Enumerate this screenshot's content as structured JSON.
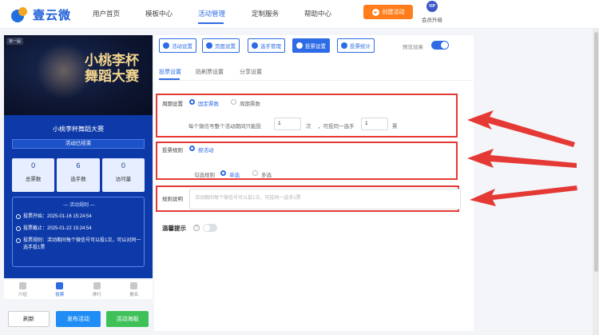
{
  "brand": {
    "name": "壹云微"
  },
  "nav": {
    "items": [
      "用户首页",
      "模板中心",
      "活动管理",
      "定制服务",
      "帮助中心"
    ],
    "active": "活动管理",
    "create_label": "创建活动",
    "vip_badge": "VIP",
    "vip_label": "会员升级"
  },
  "preview": {
    "corner_tag": "第一届",
    "banner_title_line1": "小桃李杯",
    "banner_title_line2": "舞蹈大赛",
    "activity_name": "小桃李杯舞蹈大赛",
    "status": "活动已结束",
    "stats": [
      {
        "value": "0",
        "label": "总票数"
      },
      {
        "value": "6",
        "label": "选手数"
      },
      {
        "value": "0",
        "label": "访问量"
      }
    ],
    "rules_head": "— 活动规则 —",
    "rules": [
      "投票开始：2025-01-16 15:24:54",
      "投票截止：2025-01-22 15:24:54",
      "投票规则：活动期间每个微信号可以投1次，可以对同一选手投1票"
    ],
    "tabs": [
      "介绍",
      "投票",
      "排行",
      "报名"
    ],
    "active_tab": "投票"
  },
  "actions": {
    "refresh": "刷新",
    "publish": "发布活动",
    "poster": "活动海报"
  },
  "toolbar": {
    "buttons": [
      "活动设置",
      "页面设置",
      "选手管理",
      "投票设置",
      "投票统计"
    ],
    "active": "投票设置",
    "preview_effect": "预览效果"
  },
  "subtabs": {
    "items": [
      "投票设置",
      "防刷票设置",
      "分享设置"
    ],
    "active": "投票设置"
  },
  "period": {
    "label": "周期设置",
    "options": [
      "固定票数",
      "周期票数"
    ],
    "selected": "固定票数",
    "sentence_prefix": "每个微信号整个活动期间只能投",
    "times_value": "1",
    "times_unit": "次",
    "sentence_mid": "，可投同一选手",
    "votes_value": "1",
    "votes_unit": "票"
  },
  "rule": {
    "label": "投票规则",
    "option": "按活动",
    "check_label": "勾选规则",
    "check_options": [
      "单选",
      "多选"
    ],
    "check_selected": "单选"
  },
  "explain": {
    "label": "规则说明",
    "placeholder": "活动期间每个微信号可以投1次，可投同一选手1票"
  },
  "tip": {
    "label": "温馨提示",
    "enabled": false
  },
  "colors": {
    "accent": "#2e6be6",
    "highlight": "#e53935",
    "create": "#ff7d1a",
    "publish": "#1f8df5",
    "poster": "#3fc15a"
  }
}
